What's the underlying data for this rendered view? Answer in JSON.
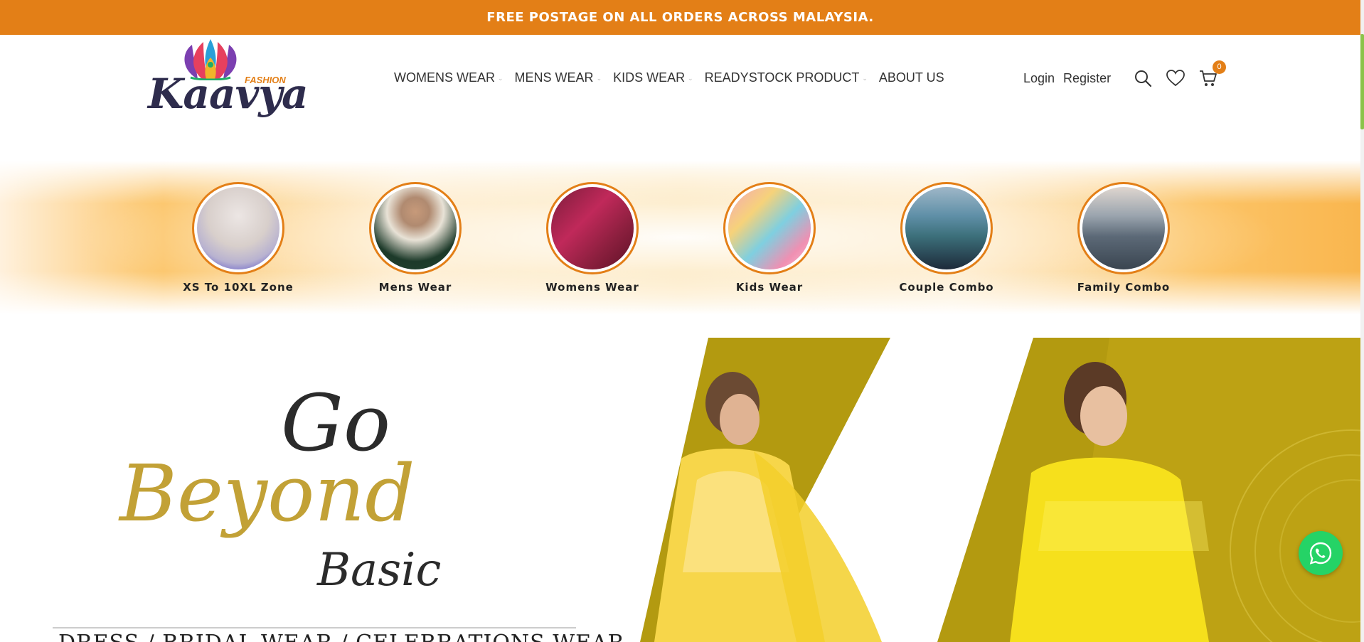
{
  "promo": {
    "text": "FREE POSTAGE ON ALL ORDERS ACROSS MALAYSIA."
  },
  "brand": {
    "name": "Kaavya",
    "sub": "FASHION",
    "mark": "®"
  },
  "nav": {
    "items": [
      {
        "label": "WOMENS WEAR",
        "has_dropdown": true
      },
      {
        "label": "MENS WEAR",
        "has_dropdown": true
      },
      {
        "label": "KIDS WEAR",
        "has_dropdown": true
      },
      {
        "label": "READYSTOCK PRODUCT",
        "has_dropdown": true
      },
      {
        "label": "ABOUT US",
        "has_dropdown": false
      }
    ]
  },
  "account": {
    "login": "Login",
    "register": "Register"
  },
  "icons": {
    "search": "search-icon",
    "wishlist": "heart-icon",
    "cart": "cart-icon",
    "whatsapp": "whatsapp-icon"
  },
  "cart": {
    "count": "0"
  },
  "categories": [
    {
      "label": "XS To 10XL Zone"
    },
    {
      "label": "Mens Wear"
    },
    {
      "label": "Womens Wear"
    },
    {
      "label": "Kids Wear"
    },
    {
      "label": "Couple Combo"
    },
    {
      "label": "Family Combo"
    }
  ],
  "hero": {
    "line1": "Go",
    "line2": "Beyond",
    "line3": "Basic",
    "strapline": "DRESS / BRIDAL WEAR / CELEBRATIONS WEAR"
  },
  "colors": {
    "accent": "#e37f17",
    "brand_navy": "#2e2c4d",
    "hero_gold": "#b39a10",
    "whatsapp": "#25d366"
  }
}
